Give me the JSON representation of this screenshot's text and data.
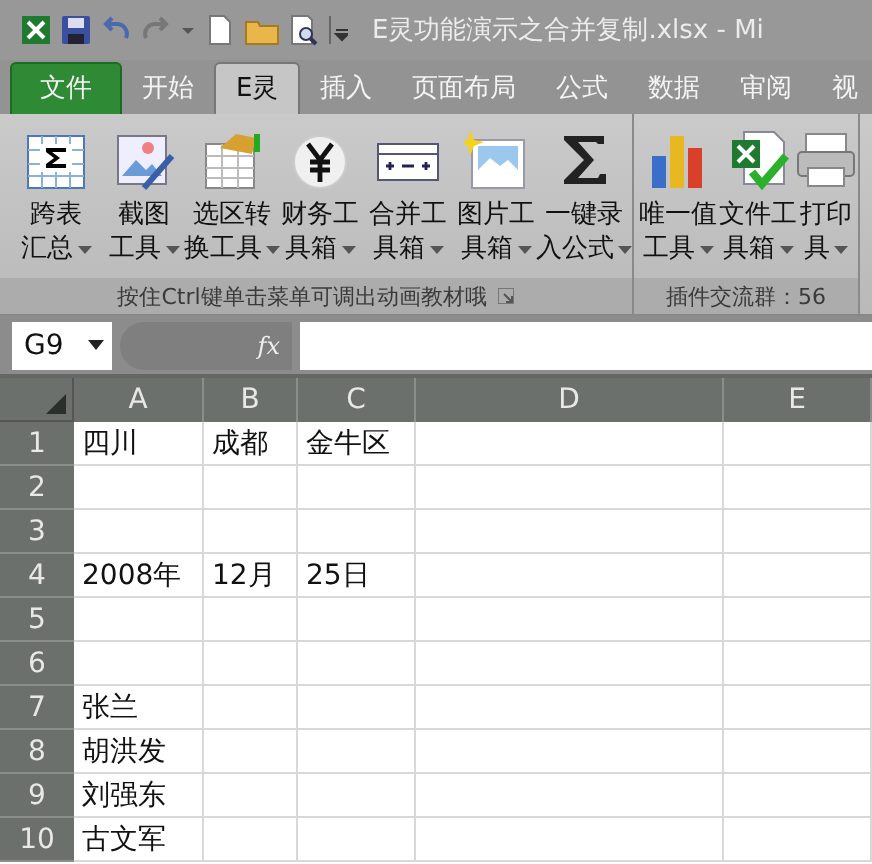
{
  "window": {
    "title": "E灵功能演示之合并复制.xlsx - Mi"
  },
  "tabs": [
    {
      "label": "文件",
      "kind": "file",
      "selected": false
    },
    {
      "label": "开始",
      "kind": "tab",
      "selected": false
    },
    {
      "label": "E灵",
      "kind": "tab",
      "selected": true
    },
    {
      "label": "插入",
      "kind": "tab",
      "selected": false
    },
    {
      "label": "页面布局",
      "kind": "tab",
      "selected": false
    },
    {
      "label": "公式",
      "kind": "tab",
      "selected": false
    },
    {
      "label": "数据",
      "kind": "tab",
      "selected": false
    },
    {
      "label": "审阅",
      "kind": "tab",
      "selected": false
    },
    {
      "label": "视",
      "kind": "tab",
      "selected": false
    }
  ],
  "ribbon": {
    "groups": [
      {
        "label": "按住Ctrl键单击菜单可调出动画教材哦",
        "buttons": [
          {
            "line1": "跨表",
            "line2": "汇总"
          },
          {
            "line1": "截图",
            "line2": "工具"
          },
          {
            "line1": "选区转",
            "line2": "换工具"
          },
          {
            "line1": "财务工",
            "line2": "具箱"
          },
          {
            "line1": "合并工",
            "line2": "具箱"
          },
          {
            "line1": "图片工",
            "line2": "具箱"
          },
          {
            "line1": "一键录",
            "line2": "入公式"
          }
        ]
      },
      {
        "label": "插件交流群：56",
        "buttons": [
          {
            "line1": "唯一值",
            "line2": "工具"
          },
          {
            "line1": "文件工",
            "line2": "具箱"
          },
          {
            "line1": "打印",
            "line2": "具"
          }
        ]
      }
    ]
  },
  "formula_bar": {
    "name_box": "G9",
    "fx": "fx"
  },
  "sheet": {
    "columns": [
      "A",
      "B",
      "C",
      "D",
      "E"
    ],
    "rows": [
      {
        "header": "1",
        "cells": [
          "四川",
          "成都",
          "金牛区"
        ]
      },
      {
        "header": "2",
        "cells": []
      },
      {
        "header": "3",
        "cells": []
      },
      {
        "header": "4",
        "cells": [
          "2008年",
          "12月",
          "25日"
        ]
      },
      {
        "header": "5",
        "cells": []
      },
      {
        "header": "6",
        "cells": []
      },
      {
        "header": "7",
        "cells": [
          "张兰"
        ]
      },
      {
        "header": "8",
        "cells": [
          "胡洪发"
        ]
      },
      {
        "header": "9",
        "cells": [
          "刘强东"
        ]
      },
      {
        "header": "10",
        "cells": [
          "古文军"
        ]
      }
    ]
  }
}
